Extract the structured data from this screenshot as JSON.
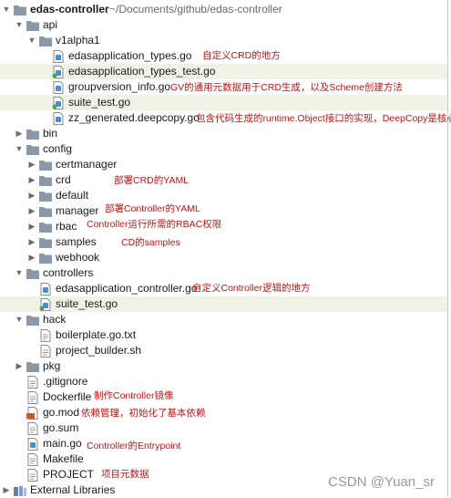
{
  "colors": {
    "folder": "#8a98a8",
    "go_file": "#4a8fd6",
    "red_note": "#c41414",
    "highlight": "#eef3e6"
  },
  "root": {
    "name": "edas-controller",
    "path": "~/Documents/github/edas-controller"
  },
  "tree": [
    {
      "depth": 1,
      "arrow": "open",
      "icon": "folder",
      "label": "api"
    },
    {
      "depth": 2,
      "arrow": "open",
      "icon": "folder",
      "label": "v1alpha1"
    },
    {
      "depth": 3,
      "arrow": "none",
      "icon": "go-file-icon",
      "label": "edasapplication_types.go"
    },
    {
      "depth": 3,
      "arrow": "none",
      "icon": "go-test-file-icon",
      "label": "edasapplication_types_test.go",
      "hl": true
    },
    {
      "depth": 3,
      "arrow": "none",
      "icon": "go-file-icon",
      "label": "groupversion_info.go"
    },
    {
      "depth": 3,
      "arrow": "none",
      "icon": "go-test-file-icon",
      "label": "suite_test.go",
      "hl": true
    },
    {
      "depth": 3,
      "arrow": "none",
      "icon": "go-file-icon",
      "label": "zz_generated.deepcopy.go"
    },
    {
      "depth": 1,
      "arrow": "closed",
      "icon": "folder",
      "label": "bin"
    },
    {
      "depth": 1,
      "arrow": "open",
      "icon": "folder",
      "label": "config"
    },
    {
      "depth": 2,
      "arrow": "closed",
      "icon": "folder",
      "label": "certmanager"
    },
    {
      "depth": 2,
      "arrow": "closed",
      "icon": "folder",
      "label": "crd"
    },
    {
      "depth": 2,
      "arrow": "closed",
      "icon": "folder",
      "label": "default"
    },
    {
      "depth": 2,
      "arrow": "closed",
      "icon": "folder",
      "label": "manager"
    },
    {
      "depth": 2,
      "arrow": "closed",
      "icon": "folder",
      "label": "rbac"
    },
    {
      "depth": 2,
      "arrow": "closed",
      "icon": "folder",
      "label": "samples"
    },
    {
      "depth": 2,
      "arrow": "closed",
      "icon": "folder",
      "label": "webhook"
    },
    {
      "depth": 1,
      "arrow": "open",
      "icon": "folder",
      "label": "controllers"
    },
    {
      "depth": 2,
      "arrow": "none",
      "icon": "go-file-icon",
      "label": "edasapplication_controller.go"
    },
    {
      "depth": 2,
      "arrow": "none",
      "icon": "go-test-file-icon",
      "label": "suite_test.go",
      "hl": true
    },
    {
      "depth": 1,
      "arrow": "open",
      "icon": "folder",
      "label": "hack"
    },
    {
      "depth": 2,
      "arrow": "none",
      "icon": "text-file-icon",
      "label": "boilerplate.go.txt"
    },
    {
      "depth": 2,
      "arrow": "none",
      "icon": "text-file-icon",
      "label": "project_builder.sh"
    },
    {
      "depth": 1,
      "arrow": "closed",
      "icon": "folder",
      "label": "pkg"
    },
    {
      "depth": 1,
      "arrow": "none",
      "icon": "text-file-icon",
      "label": ".gitignore"
    },
    {
      "depth": 1,
      "arrow": "none",
      "icon": "text-file-icon",
      "label": "Dockerfile"
    },
    {
      "depth": 1,
      "arrow": "none",
      "icon": "go-mod-icon",
      "label": "go.mod"
    },
    {
      "depth": 1,
      "arrow": "none",
      "icon": "text-file-icon",
      "label": "go.sum"
    },
    {
      "depth": 1,
      "arrow": "none",
      "icon": "go-file-icon",
      "label": "main.go"
    },
    {
      "depth": 1,
      "arrow": "none",
      "icon": "text-file-icon",
      "label": "Makefile"
    },
    {
      "depth": 1,
      "arrow": "none",
      "icon": "text-file-icon",
      "label": "PROJECT"
    },
    {
      "depth": 0,
      "arrow": "closed",
      "icon": "external-libraries-icon",
      "label": "External Libraries"
    }
  ],
  "notes": [
    "自定义CRD的地方",
    "GV的通用元数据用于CRD生成，以及Scheme创建方法",
    "包含代码生成的runtime.Object接口的实现，DeepCopy是核心",
    "部署CRD的YAML",
    "部署Controller的YAML",
    "Controller运行所需的RBAC权限",
    "CD的samples",
    "自定义Controller逻辑的地方",
    "制作Controller镜像",
    "依赖管理，初始化了基本依赖",
    "Controller的Entrypoint",
    "项目元数据"
  ],
  "watermark": "CSDN @Yuan_sr"
}
